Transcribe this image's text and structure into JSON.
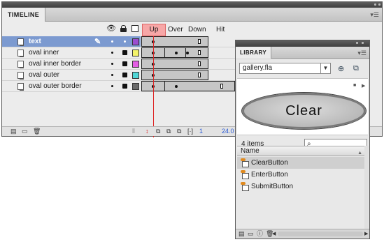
{
  "timeline": {
    "title": "TIMELINE",
    "frame_labels": {
      "up": "Up",
      "over": "Over",
      "down": "Down",
      "hit": "Hit"
    },
    "layers": [
      {
        "name": "text",
        "color": "#9b4dd1",
        "selected": true
      },
      {
        "name": "oval inner",
        "color": "#f3f36a",
        "selected": false
      },
      {
        "name": "oval inner border",
        "color": "#e45ee4",
        "selected": false
      },
      {
        "name": "oval outer",
        "color": "#4fd6d6",
        "selected": false
      },
      {
        "name": "oval outer border",
        "color": "#6a6a6a",
        "selected": false
      }
    ],
    "current_frame": "1",
    "frame_rate": "24.0"
  },
  "library": {
    "title": "LIBRARY",
    "document": "gallery.fla",
    "preview_label": "Clear",
    "item_count": "4 items",
    "search_placeholder": "",
    "column_name": "Name",
    "items": [
      {
        "name": "ClearButton",
        "highlighted": true
      },
      {
        "name": "EnterButton",
        "highlighted": false
      },
      {
        "name": "SubmitButton",
        "highlighted": false
      }
    ]
  }
}
